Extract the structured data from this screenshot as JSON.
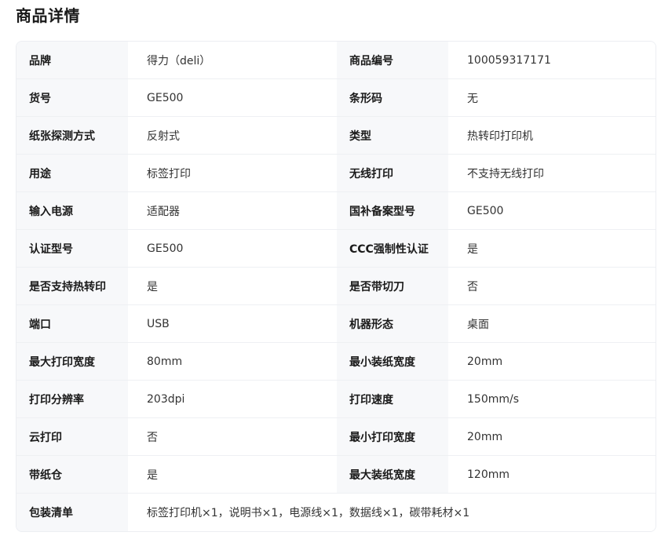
{
  "section_title": "商品详情",
  "rows": [
    {
      "l1": "品牌",
      "v1": "得力（deli）",
      "l2": "商品编号",
      "v2": "100059317171"
    },
    {
      "l1": "货号",
      "v1": "GE500",
      "l2": "条形码",
      "v2": "无"
    },
    {
      "l1": "纸张探测方式",
      "v1": "反射式",
      "l2": "类型",
      "v2": "热转印打印机"
    },
    {
      "l1": "用途",
      "v1": "标签打印",
      "l2": "无线打印",
      "v2": "不支持无线打印"
    },
    {
      "l1": "输入电源",
      "v1": "适配器",
      "l2": "国补备案型号",
      "v2": "GE500"
    },
    {
      "l1": "认证型号",
      "v1": "GE500",
      "l2": "CCC强制性认证",
      "v2": "是"
    },
    {
      "l1": "是否支持热转印",
      "v1": "是",
      "l2": "是否带切刀",
      "v2": "否"
    },
    {
      "l1": "端口",
      "v1": "USB",
      "l2": "机器形态",
      "v2": "桌面"
    },
    {
      "l1": "最大打印宽度",
      "v1": "80mm",
      "l2": "最小装纸宽度",
      "v2": "20mm"
    },
    {
      "l1": "打印分辨率",
      "v1": "203dpi",
      "l2": "打印速度",
      "v2": "150mm/s"
    },
    {
      "l1": "云打印",
      "v1": "否",
      "l2": "最小打印宽度",
      "v2": "20mm"
    },
    {
      "l1": "带纸仓",
      "v1": "是",
      "l2": "最大装纸宽度",
      "v2": "120mm"
    }
  ],
  "package": {
    "label": "包装清单",
    "value": "标签打印机×1，说明书×1，电源线×1，数据线×1，碳带耗材×1"
  }
}
